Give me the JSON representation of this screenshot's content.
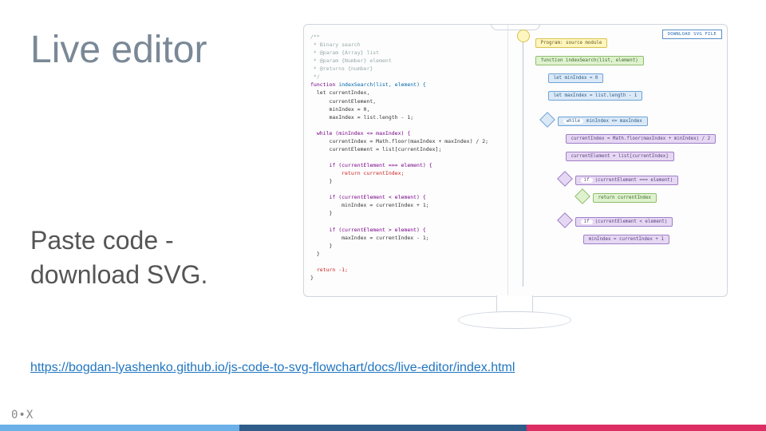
{
  "slide": {
    "title": "Live editor",
    "subtitle_l1": "Paste code -",
    "subtitle_l2": "download SVG.",
    "url": "https://bogdan-lyashenko.github.io/js-code-to-svg-flowchart/docs/live-editor/index.html",
    "logo": "0•X"
  },
  "footer": {
    "c1": "#6bb0e8",
    "w1": 300,
    "c2": "#2f5d8a",
    "w2": 360,
    "c3": "#dd2e63",
    "w3": 300
  },
  "app": {
    "download_label": "DOWNLOAD SVG FILE"
  },
  "code": {
    "c1": "/**",
    "c2": " * Binary search",
    "c3": " * @param {Array} list",
    "c4": " * @param {Number} element",
    "c5": " * @returns {number}",
    "c6": " */",
    "fn": "function ",
    "fnname": "indexSearch(list, element) {",
    "let": "  let currentIndex,",
    "let2": "      currentElement,",
    "let3": "      minIndex = 0,",
    "let4": "      maxIndex = list.length - 1;",
    "wh": "  while (minIndex <= maxIndex) {",
    "a1": "      currentIndex = Math.floor(maxIndex + maxIndex) / 2;",
    "a2": "      currentElement = list[currentIndex];",
    "if1": "      if (currentElement === element) {",
    "ret1": "          return currentIndex;",
    "cb": "      }",
    "if2": "      if (currentElement < element) {",
    "as2": "          minIndex = currentIndex + 1;",
    "if3": "      if (currentElement > element) {",
    "as3": "          maxIndex = currentIndex - 1;",
    "cw": "  }",
    "retn": "  return -1;",
    "end": "}"
  },
  "flow": {
    "program": "Program: source module",
    "func": "function indexSearch(list, element)",
    "min": "let minIndex = 0",
    "max": "let maxIndex = list.length - 1",
    "while_lbl": "while",
    "while_cond": "minIndex <= maxIndex",
    "l1": "currentIndex = Math.floor(maxIndex + minIndex) / 2",
    "l2": "currentElement = list[currentIndex]",
    "if_lbl": "if",
    "if1": "(currentElement === element)",
    "ret": "return currentIndex",
    "if2": "(currentElement < element)",
    "as2": "minIndex = currentIndex + 1"
  }
}
